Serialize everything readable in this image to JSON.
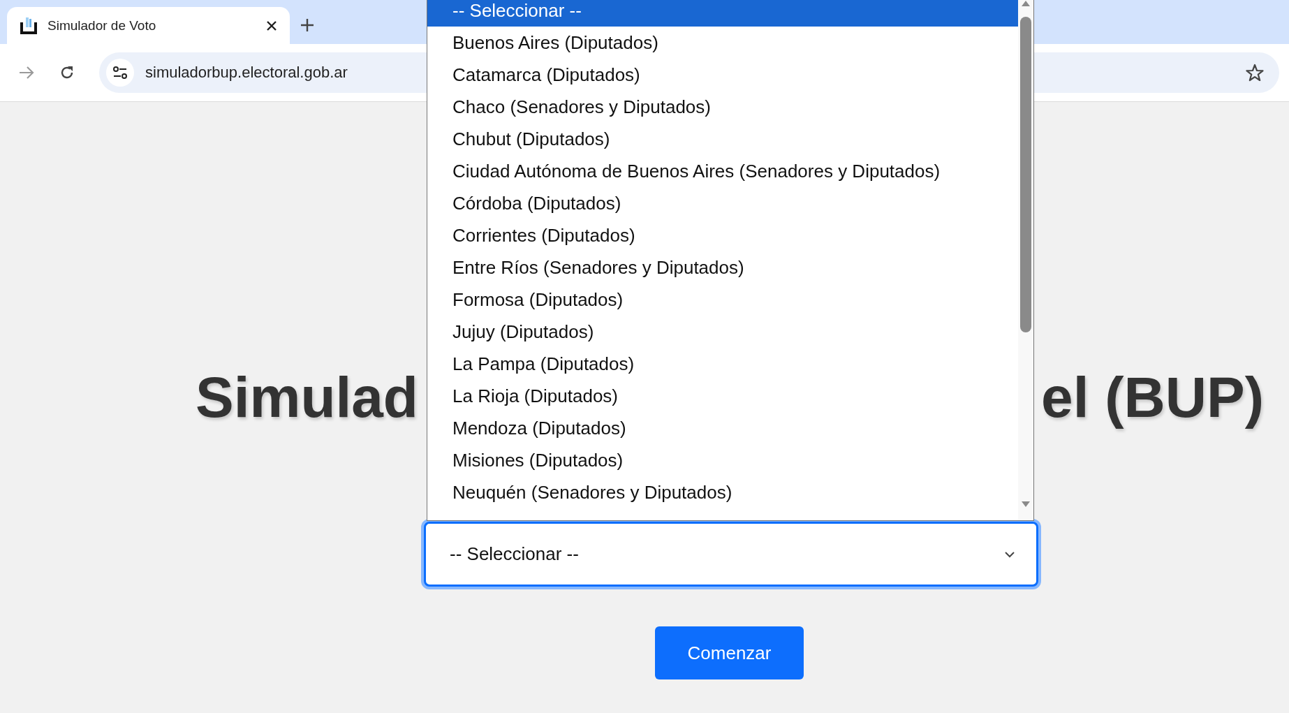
{
  "browser": {
    "tab": {
      "title": "Simulador de Voto",
      "selected": true
    },
    "address": "simuladorbup.electoral.gob.ar"
  },
  "page": {
    "title_left": "Simulad",
    "title_right": "el (BUP)",
    "select": {
      "value": "-- Seleccionar --",
      "expanded": true
    },
    "button": "Comenzar"
  },
  "dropdown": {
    "options": [
      {
        "label": "-- Seleccionar --",
        "selected": true
      },
      {
        "label": "Buenos Aires (Diputados)",
        "selected": false
      },
      {
        "label": "Catamarca (Diputados)",
        "selected": false
      },
      {
        "label": "Chaco (Senadores y Diputados)",
        "selected": false
      },
      {
        "label": "Chubut (Diputados)",
        "selected": false
      },
      {
        "label": "Ciudad Autónoma de Buenos Aires (Senadores y Diputados)",
        "selected": false
      },
      {
        "label": "Córdoba (Diputados)",
        "selected": false
      },
      {
        "label": "Corrientes (Diputados)",
        "selected": false
      },
      {
        "label": "Entre Ríos (Senadores y Diputados)",
        "selected": false
      },
      {
        "label": "Formosa (Diputados)",
        "selected": false
      },
      {
        "label": "Jujuy (Diputados)",
        "selected": false
      },
      {
        "label": "La Pampa (Diputados)",
        "selected": false
      },
      {
        "label": "La Rioja (Diputados)",
        "selected": false
      },
      {
        "label": "Mendoza (Diputados)",
        "selected": false
      },
      {
        "label": "Misiones (Diputados)",
        "selected": false
      },
      {
        "label": "Neuquén (Senadores y Diputados)",
        "selected": false
      }
    ]
  }
}
